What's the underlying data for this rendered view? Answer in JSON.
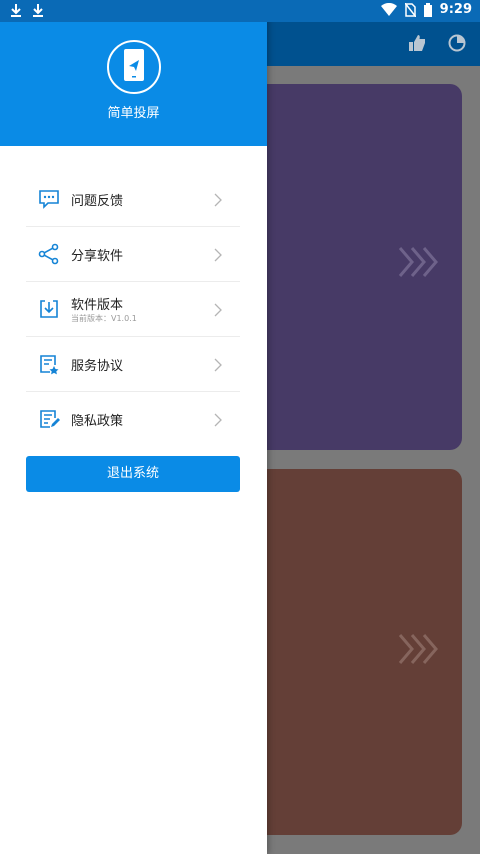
{
  "status_bar": {
    "time": "9:29",
    "left_icons": [
      "download-icon",
      "download-icon"
    ],
    "right_icons": [
      "wifi-icon",
      "no-sim-icon",
      "battery-icon"
    ]
  },
  "background": {
    "toolbar_icons": [
      "thumb-up-icon",
      "pie-chart-icon"
    ],
    "cards": [
      {
        "color": "#473a66",
        "icon": "chevrons-right-icon"
      },
      {
        "color": "#643f37",
        "icon": "chevrons-right-icon"
      }
    ]
  },
  "drawer": {
    "header_color": "#0a8be6",
    "app_name": "简单投屏",
    "logo_icon": "phone-send-icon",
    "menu": [
      {
        "label": "问题反馈",
        "icon": "feedback-icon"
      },
      {
        "label": "分享软件",
        "icon": "share-icon"
      },
      {
        "label": "软件版本",
        "subtitle": "当前版本：V1.0.1",
        "icon": "version-icon"
      },
      {
        "label": "服务协议",
        "icon": "agreement-icon"
      },
      {
        "label": "隐私政策",
        "icon": "privacy-icon"
      }
    ],
    "logout_label": "退出系统"
  }
}
